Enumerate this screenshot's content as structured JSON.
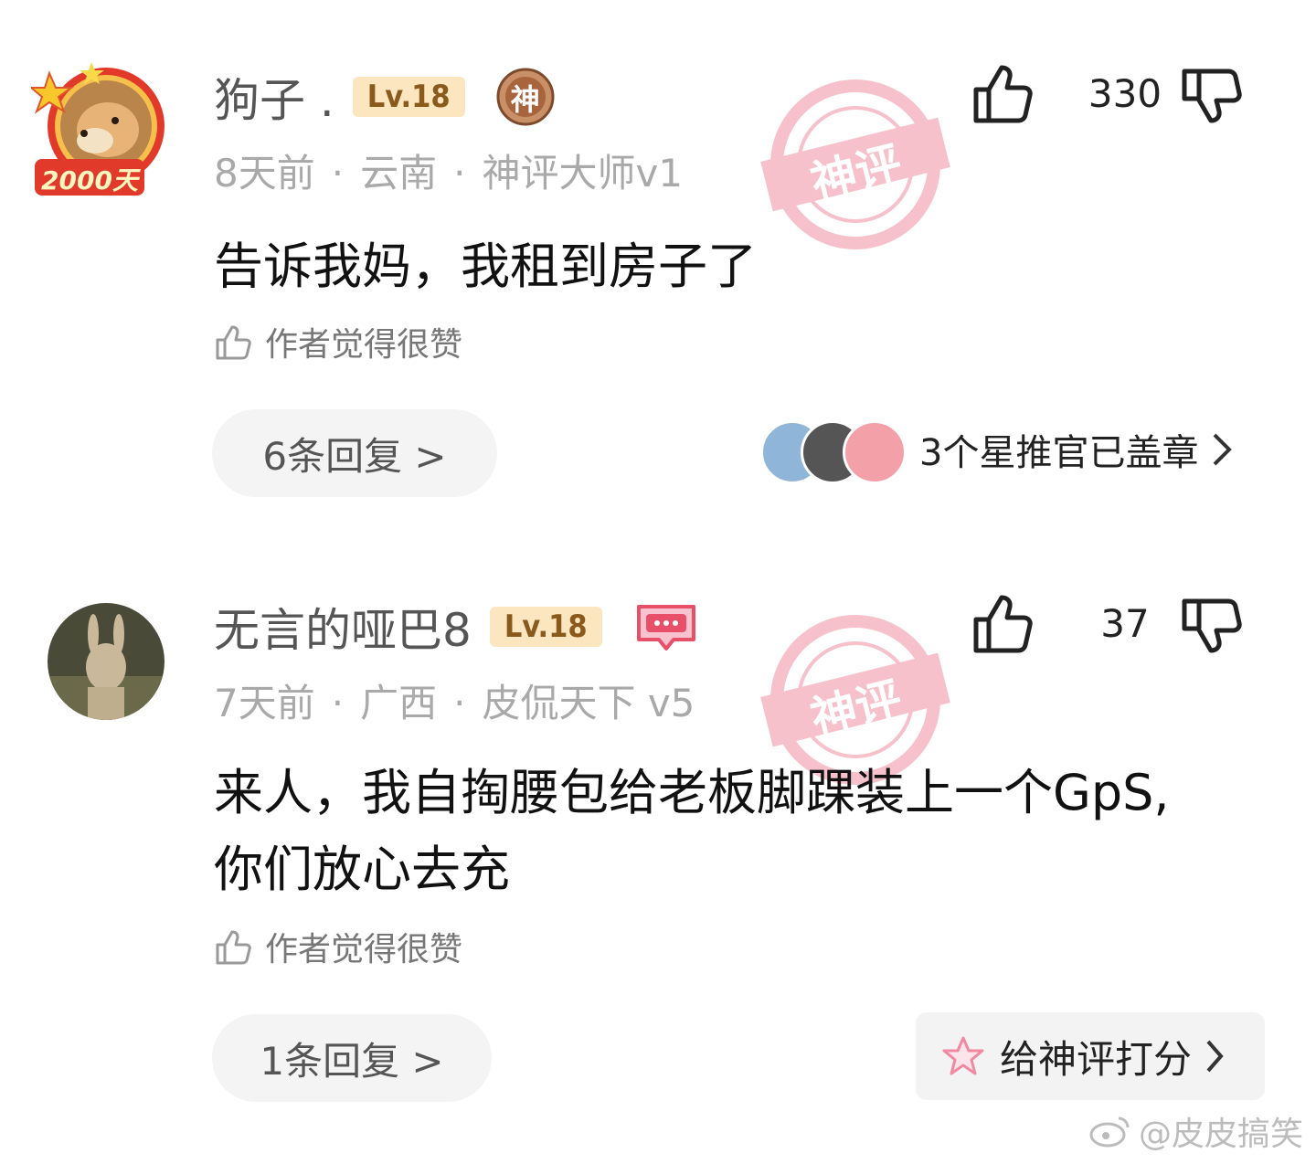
{
  "comments": [
    {
      "username": "狗子 .",
      "level": "Lv.18",
      "badge_text": "神",
      "avatar_badge_text": "2000天",
      "time": "8天前",
      "region": "云南",
      "title": "神评大师v1",
      "like_count": "330",
      "stamp_text": "神评",
      "content": "告诉我妈，我租到房子了",
      "author_liked": "作者觉得很赞",
      "reply_label": "6条回复 >",
      "star_pushers_label": "3个星推官已盖章"
    },
    {
      "username": "无言的哑巴8",
      "level": "Lv.18",
      "time": "7天前",
      "region": "广西",
      "title": "皮侃天下 v5",
      "like_count": "37",
      "stamp_text": "神评",
      "content_line1": "来人，我自掏腰包给老板脚踝装上一个GpS,",
      "content_line2": "你们放心去充",
      "author_liked": "作者觉得很赞",
      "reply_label": "1条回复 >",
      "rate_label": "给神评打分"
    }
  ],
  "watermark": "@皮皮搞笑",
  "colors": {
    "level_bg": "#fbe6c0",
    "level_text": "#8a5a1c",
    "stamp": "#e8506a",
    "meta_gray": "#a9a9a9"
  }
}
